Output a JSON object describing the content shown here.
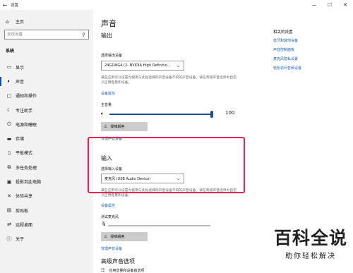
{
  "window": {
    "title": "设置"
  },
  "sidebar": {
    "home": "主页",
    "search_placeholder": "查找设置",
    "section": "系统",
    "items": [
      {
        "label": "显示",
        "icon": "display-icon"
      },
      {
        "label": "声音",
        "icon": "speaker-icon",
        "active": true
      },
      {
        "label": "通知和操作",
        "icon": "notification-icon"
      },
      {
        "label": "专注助手",
        "icon": "focus-assist-icon"
      },
      {
        "label": "电源和睡眠",
        "icon": "power-icon"
      },
      {
        "label": "存储",
        "icon": "storage-icon"
      },
      {
        "label": "平板模式",
        "icon": "tablet-icon"
      },
      {
        "label": "多任务处理",
        "icon": "multitasking-icon"
      },
      {
        "label": "投影到此电脑",
        "icon": "project-icon"
      },
      {
        "label": "体验共享",
        "icon": "shared-experiences-icon"
      },
      {
        "label": "剪贴板",
        "icon": "clipboard-icon"
      },
      {
        "label": "远程桌面",
        "icon": "remote-desktop-icon"
      },
      {
        "label": "关于",
        "icon": "info-icon"
      }
    ]
  },
  "main": {
    "title": "声音",
    "output": {
      "heading": "输出",
      "select_label": "选择输出设备",
      "selected_device": "24G1WG4 (2- NVIDIA High Definitio...",
      "description": "某些应用可以设置为使用与此处选择的声音设备不同的声音设备。请在高级声音选项中自定义应用音量和设备。",
      "device_properties": "设备属性",
      "volume_label": "主音量",
      "volume_value": "100",
      "volume_level": 1.0,
      "troubleshoot": "疑难解答",
      "manage_devices": "管理声音设备"
    },
    "input": {
      "heading": "输入",
      "select_label": "选择输入设备",
      "selected_device": "麦克风 (USB Audio Device)",
      "description": "某些应用可以设置为使用与此处选择的声音设备不同的声音设备。请在高级声音选项中自定义应用音量和设备。",
      "device_properties": "设备属性",
      "test_label": "测试麦克风",
      "troubleshoot": "疑难解答",
      "manage_devices": "管理声音设备"
    },
    "advanced": {
      "heading": "高级声音选项",
      "item": "应用音量和设备首选项"
    }
  },
  "related": {
    "title": "相关的设置",
    "links": [
      "蓝牙和其他设备",
      "声音控制面板",
      "麦克风隐私设置",
      "轻松访问音频设置"
    ]
  },
  "watermark": {
    "main": "百科全说",
    "sub": "助你轻松解决"
  },
  "colors": {
    "accent": "#1a4d99",
    "link": "#1a5fb4",
    "highlight": "#e8234f",
    "sidebar_bg": "#f2f2f2"
  }
}
